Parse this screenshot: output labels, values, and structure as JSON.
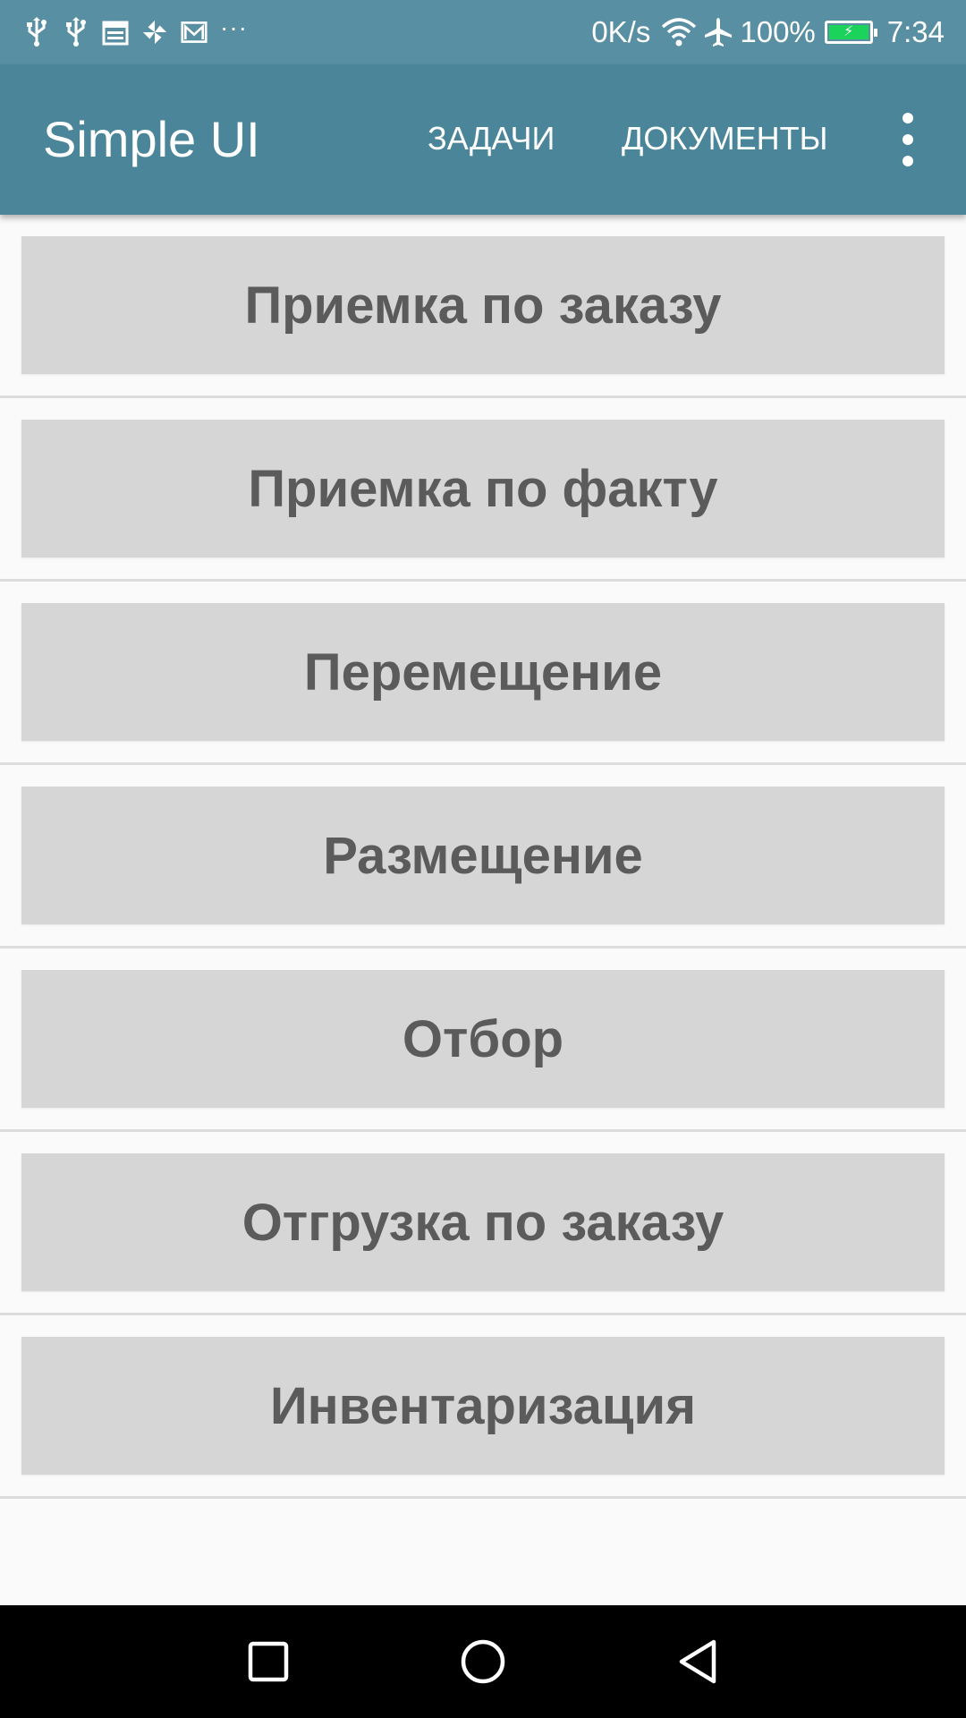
{
  "status_bar": {
    "icons_left": [
      "usb-icon",
      "usb-icon",
      "calendar-icon",
      "pinwheel-icon",
      "mail-icon"
    ],
    "overflow_indicator": "···",
    "net_speed": "0K/s",
    "icons_right": [
      "wifi-icon",
      "airplane-mode-icon"
    ],
    "battery_percent": "100%",
    "battery_level": 1.0,
    "time": "7:34"
  },
  "app_bar": {
    "title": "Simple UI",
    "actions": {
      "tasks": "ЗАДАЧИ",
      "documents": "ДОКУМЕНТЫ"
    },
    "overflow_icon": "more-vert-icon"
  },
  "menu": {
    "items": [
      {
        "label": "Приемка по заказу"
      },
      {
        "label": "Приемка по факту"
      },
      {
        "label": "Перемещение"
      },
      {
        "label": "Размещение"
      },
      {
        "label": "Отбор"
      },
      {
        "label": "Отгрузка по заказу"
      },
      {
        "label": "Инвентаризация"
      }
    ]
  },
  "nav_bar": {
    "buttons": [
      "recent-apps-icon",
      "home-icon",
      "back-icon"
    ]
  },
  "colors": {
    "status_bar": "#588fa2",
    "app_bar": "#4a8599",
    "button_bg": "#d6d6d6",
    "button_text": "#5b5b5b",
    "background": "#fafafa",
    "battery_fill": "#1bd35a"
  }
}
